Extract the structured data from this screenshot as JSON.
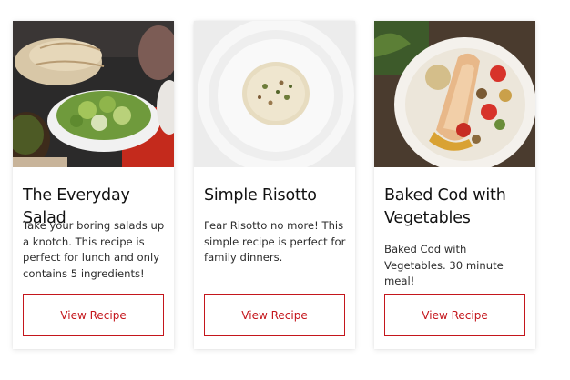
{
  "theme": {
    "accent": "#c4161c",
    "text": "#111111",
    "body_text": "#2d2d2d"
  },
  "cards": [
    {
      "title": "The Everyday Salad",
      "description": "Take your boring salads up a knotch. This recipe is perfect for lunch and only contains 5 ingredients!",
      "button_label": "View Recipe",
      "image": "salad-photo"
    },
    {
      "title": "Simple Risotto",
      "description": "Fear Risotto no more! This simple recipe is perfect for family dinners.",
      "button_label": "View Recipe",
      "image": "risotto-photo"
    },
    {
      "title": "Baked Cod with Vegetables",
      "description": "Baked Cod with Vegetables. 30 minute meal!",
      "button_label": "View Recipe",
      "image": "baked-cod-photo"
    }
  ]
}
